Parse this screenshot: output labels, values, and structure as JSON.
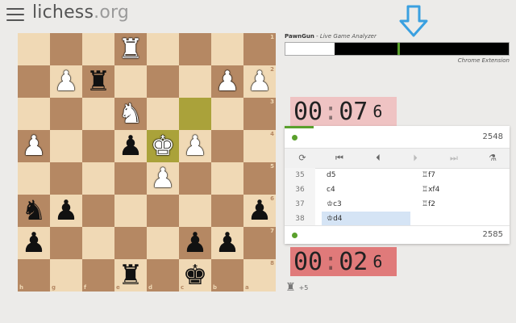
{
  "header": {
    "logo_main": "lichess",
    "logo_tld": ".org"
  },
  "board": {
    "ranks": [
      "1",
      "2",
      "3",
      "4",
      "5",
      "6",
      "7",
      "8"
    ],
    "files": [
      "h",
      "g",
      "f",
      "e",
      "d",
      "c",
      "b",
      "a"
    ],
    "pieces": [
      {
        "glyph": "♜",
        "color": "w",
        "r": 0,
        "c": 3,
        "name": "white-rook-piece"
      },
      {
        "glyph": "♟",
        "color": "w",
        "r": 1,
        "c": 1,
        "name": "white-pawn-piece"
      },
      {
        "glyph": "♜",
        "color": "b",
        "r": 1,
        "c": 2,
        "name": "black-rook-piece"
      },
      {
        "glyph": "♟",
        "color": "w",
        "r": 1,
        "c": 6,
        "name": "white-pawn-piece"
      },
      {
        "glyph": "♟",
        "color": "w",
        "r": 1,
        "c": 7,
        "name": "white-pawn-piece"
      },
      {
        "glyph": "♞",
        "color": "w",
        "r": 2,
        "c": 3,
        "name": "white-knight-piece"
      },
      {
        "glyph": "♟",
        "color": "w",
        "r": 3,
        "c": 0,
        "name": "white-pawn-piece"
      },
      {
        "glyph": "♟",
        "color": "b",
        "r": 3,
        "c": 3,
        "name": "black-pawn-piece"
      },
      {
        "glyph": "♚",
        "color": "w",
        "r": 3,
        "c": 4,
        "name": "white-king-piece"
      },
      {
        "glyph": "♟",
        "color": "w",
        "r": 3,
        "c": 5,
        "name": "white-pawn-piece"
      },
      {
        "glyph": "♟",
        "color": "w",
        "r": 4,
        "c": 4,
        "name": "white-pawn-piece"
      },
      {
        "glyph": "♞",
        "color": "b",
        "r": 5,
        "c": 0,
        "name": "black-knight-piece"
      },
      {
        "glyph": "♟",
        "color": "b",
        "r": 5,
        "c": 1,
        "name": "black-pawn-piece"
      },
      {
        "glyph": "♟",
        "color": "b",
        "r": 5,
        "c": 7,
        "name": "black-pawn-piece"
      },
      {
        "glyph": "♟",
        "color": "b",
        "r": 6,
        "c": 0,
        "name": "black-pawn-piece"
      },
      {
        "glyph": "♟",
        "color": "b",
        "r": 6,
        "c": 5,
        "name": "black-pawn-piece"
      },
      {
        "glyph": "♟",
        "color": "b",
        "r": 6,
        "c": 6,
        "name": "black-pawn-piece"
      },
      {
        "glyph": "♜",
        "color": "b",
        "r": 7,
        "c": 3,
        "name": "black-rook-piece"
      },
      {
        "glyph": "♚",
        "color": "b",
        "r": 7,
        "c": 5,
        "name": "black-king-piece"
      }
    ],
    "highlight": [
      {
        "r": 2,
        "c": 5
      },
      {
        "r": 3,
        "c": 4
      }
    ]
  },
  "analyzer": {
    "name": "PawnGun",
    "subtitle": " - Live Game Analyzer",
    "eval_white_fraction": 0.22,
    "eval_marker_fraction": 0.5,
    "chrome_ext": "Chrome Extension"
  },
  "clock_top": {
    "mm": "00",
    "ss": "07",
    "tenth": "6"
  },
  "clock_bottom": {
    "mm": "00",
    "ss": "02",
    "tenth": "6"
  },
  "rating_top": "2548",
  "rating_bottom": "2585",
  "controls": [
    "⟳",
    "⏮",
    "⏴",
    "⏵",
    "⏭",
    "⚗"
  ],
  "moves": [
    {
      "num": "35",
      "w": "d5",
      "b": "♖f7"
    },
    {
      "num": "36",
      "w": "c4",
      "b": "♖xf4"
    },
    {
      "num": "37",
      "w": "♔c3",
      "b": "♖f2"
    },
    {
      "num": "38",
      "w": "♔d4",
      "b": ""
    }
  ],
  "active_move": "38w",
  "under_board": {
    "piece": "♜",
    "text": "+5"
  },
  "colors": {
    "accent": "#5aa02c",
    "arrow": "#3aa0e0"
  }
}
